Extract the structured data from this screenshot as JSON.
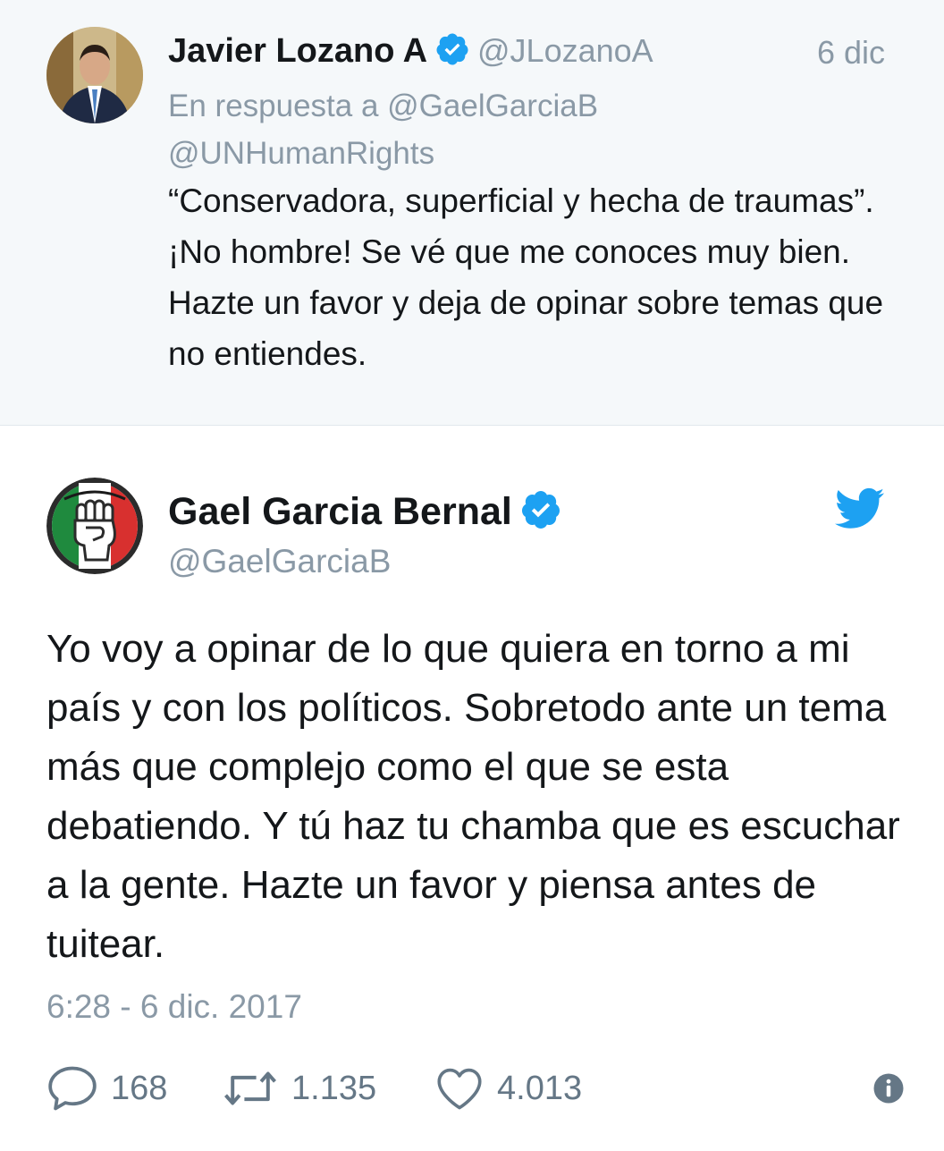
{
  "reply": {
    "name": "Javier Lozano A",
    "handle": "@JLozanoA",
    "date": "6 dic",
    "context_line1": "En respuesta a @GaelGarciaB",
    "context_line2": "@UNHumanRights",
    "text": "“Conservadora, superficial y hecha de traumas”. ¡No hombre! Se vé que me conoces muy bien. Hazte un favor y deja de opinar sobre temas que no entiendes.",
    "avatar_icon": "profile-photo"
  },
  "tweet": {
    "name": "Gael Garcia Bernal",
    "handle": "@GaelGarciaB",
    "text": "Yo voy a opinar de lo que quiera en torno a mi país y con los políticos. Sobretodo ante un tema más que complejo como el que se esta debatiendo. Y tú haz tu chamba que es escuchar a la gente. Hazte un favor y piensa antes de tuitear.",
    "timestamp": "6:28 - 6 dic. 2017",
    "avatar_icon": "raised-fist-logo",
    "platform_icon": "twitter-bird-icon"
  },
  "actions": {
    "replies": "168",
    "retweets": "1.135",
    "likes": "4.013"
  },
  "colors": {
    "verified_blue": "#1da1f2",
    "reply_background": "#f5f8fa",
    "secondary_text": "#8a99a6",
    "icon_gray": "#657786"
  }
}
